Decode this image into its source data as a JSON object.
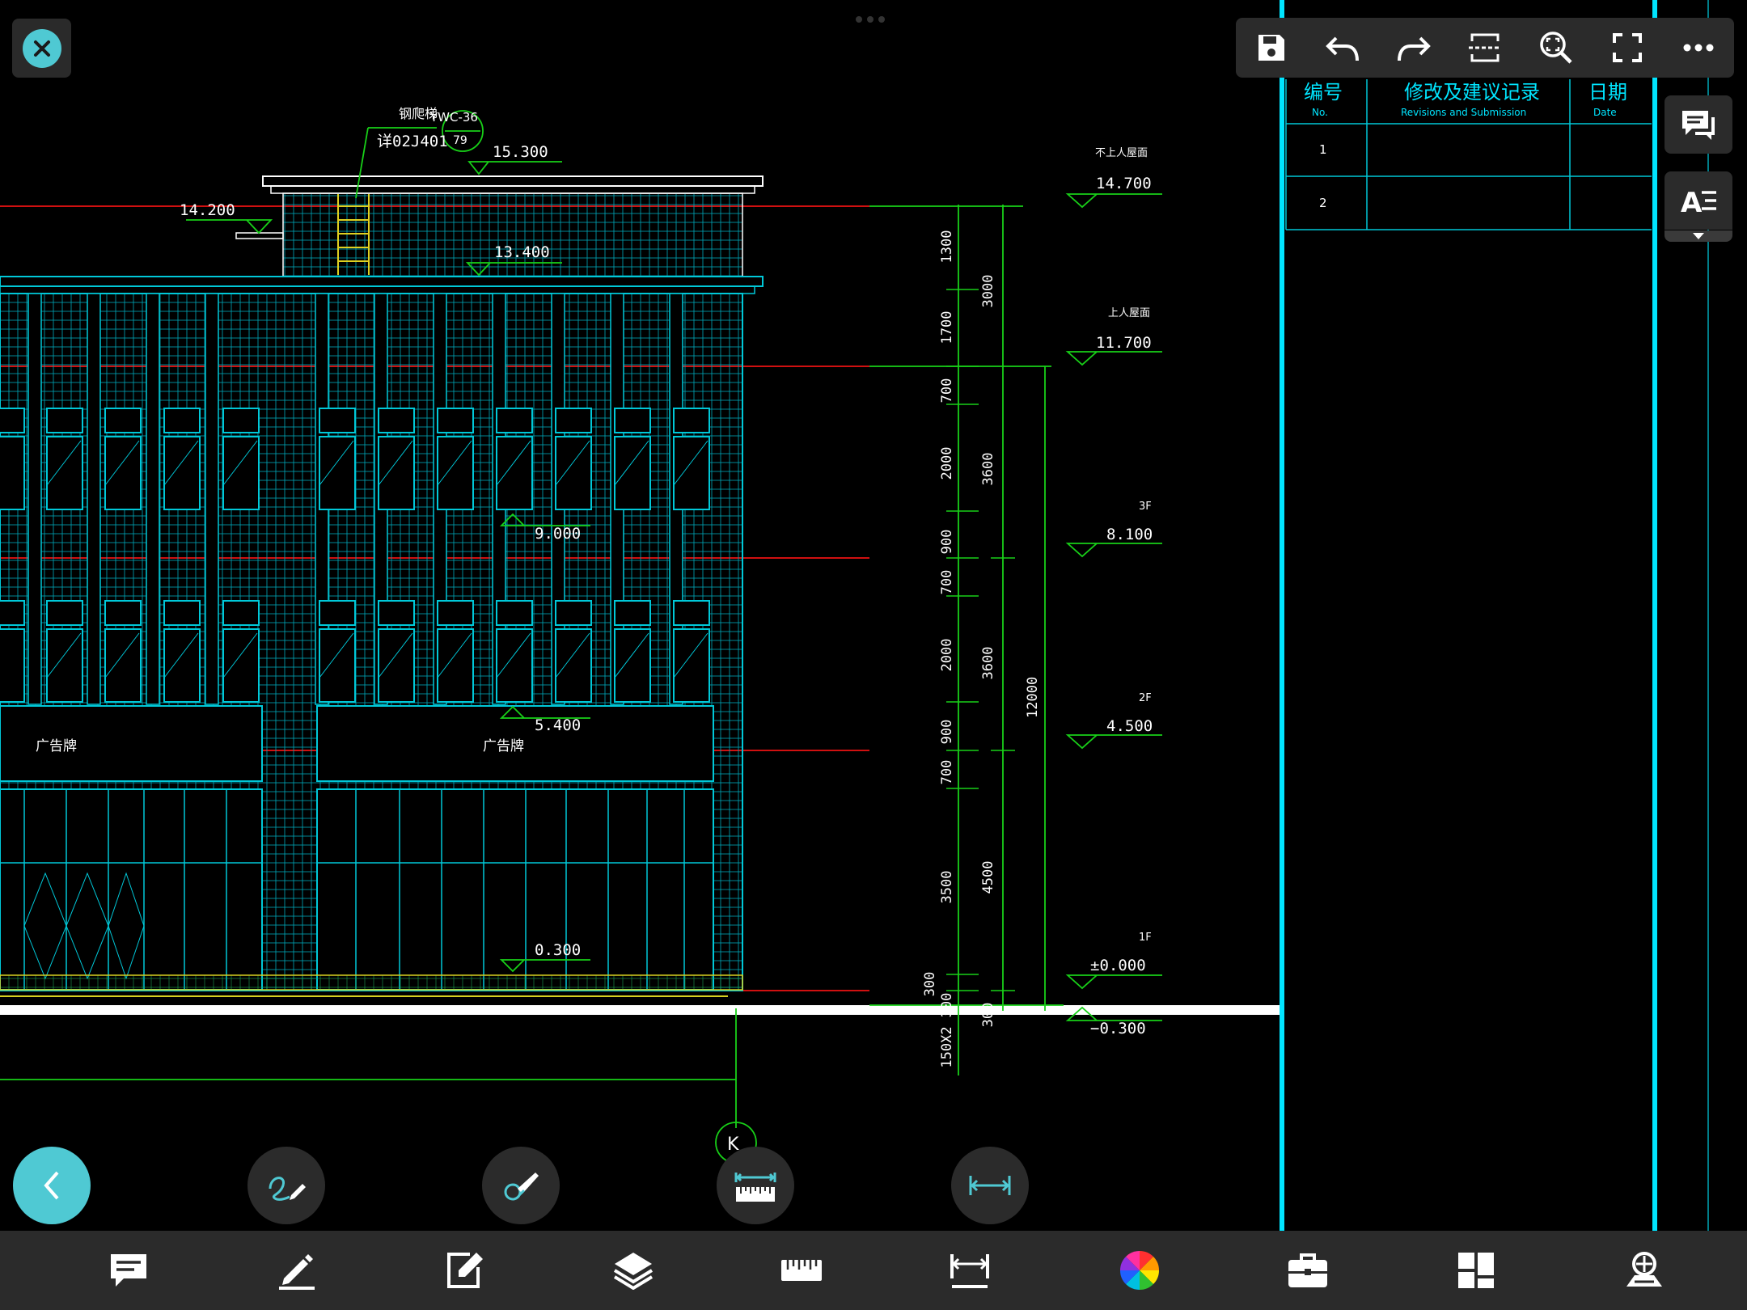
{
  "window": {
    "title": ""
  },
  "drawing": {
    "elevations": {
      "roof_top": "15.300",
      "parapet_left": "14.200",
      "roof_mid": "13.400",
      "floor3_mid": "9.000",
      "floor2_mid": "5.400",
      "ground_mid": "0.300",
      "right_14700": "14.700",
      "right_11700": "11.700",
      "right_8100": "8.100",
      "right_4500": "4.500",
      "right_000": "±0.000",
      "right_neg300": "−0.300"
    },
    "right_labels": {
      "no_roof": "不上人屋面",
      "roof_access": "上人屋面",
      "f3": "3F",
      "f2": "2F",
      "f1": "1F"
    },
    "annotations": {
      "ladder": "钢爬梯",
      "ladder_code": "YWC-36",
      "ladder_ref": "详02J401",
      "ladder_page": "79",
      "billboard_left": "广告牌",
      "billboard_right": "广告牌",
      "grid_axis": "K"
    },
    "dims_left": [
      "1300",
      "1700",
      "700",
      "2000",
      "900",
      "700",
      "2000",
      "900",
      "700",
      "3500",
      "300",
      "300",
      "150X2"
    ],
    "dims_mid": [
      "3000",
      "3600",
      "3600",
      "4500",
      "300"
    ],
    "dims_total": "12000"
  },
  "revision_table": {
    "col_no": "编号",
    "col_no_en": "No.",
    "col_rev": "修改及建议记录",
    "col_rev_en": "Revisions and Submission",
    "col_date": "日期",
    "col_date_en": "Date",
    "rows": [
      "1",
      "2"
    ]
  },
  "toolbar": {
    "save": "save-icon",
    "undo": "undo-icon",
    "redo": "redo-icon",
    "section": "section-icon",
    "zoom": "zoom-extents-icon",
    "fullscreen": "fullscreen-icon",
    "more": "more-icon"
  },
  "side_tools": {
    "comments": "comments-icon",
    "text_style": "text-style-icon"
  },
  "fabs": [
    "back-icon",
    "sketch-icon",
    "brush-icon",
    "measure-ruler-icon",
    "dimension-icon"
  ],
  "bottom_bar": [
    "comment-icon",
    "pen-icon",
    "edit-icon",
    "layers-icon",
    "ruler-icon",
    "dimension-icon",
    "color-wheel-icon",
    "toolbox-icon",
    "layout-icon",
    "view-icon"
  ],
  "colors": {
    "accent": "#4fc9d3",
    "cad_cyan": "#00e5ff",
    "cad_green": "#18d018",
    "cad_red": "#e01010",
    "cad_yellow": "#d8d020",
    "toolbar_bg": "#2b2b2b"
  }
}
